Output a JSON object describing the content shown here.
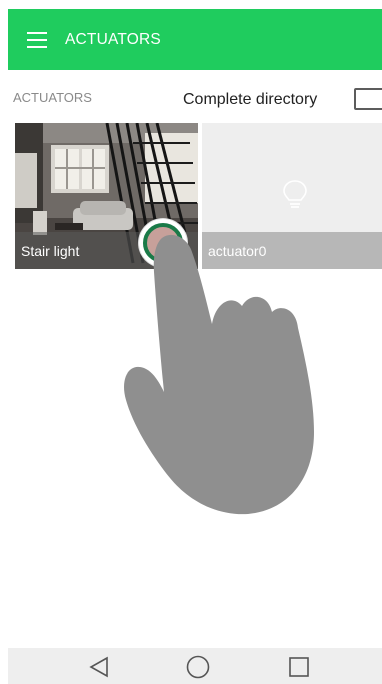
{
  "appbar": {
    "title": "ACTUATORS",
    "color": "#1fcc5e"
  },
  "section": {
    "label": "ACTUATORS"
  },
  "directory": {
    "label": "Complete directory"
  },
  "cards": [
    {
      "label": "Stair light",
      "image": "living-room-with-staircase"
    },
    {
      "label": "actuator0",
      "icon": "lightbulb-outline-icon"
    }
  ],
  "navbar": {
    "buttons": [
      "back-icon",
      "home-icon",
      "recents-icon"
    ]
  }
}
